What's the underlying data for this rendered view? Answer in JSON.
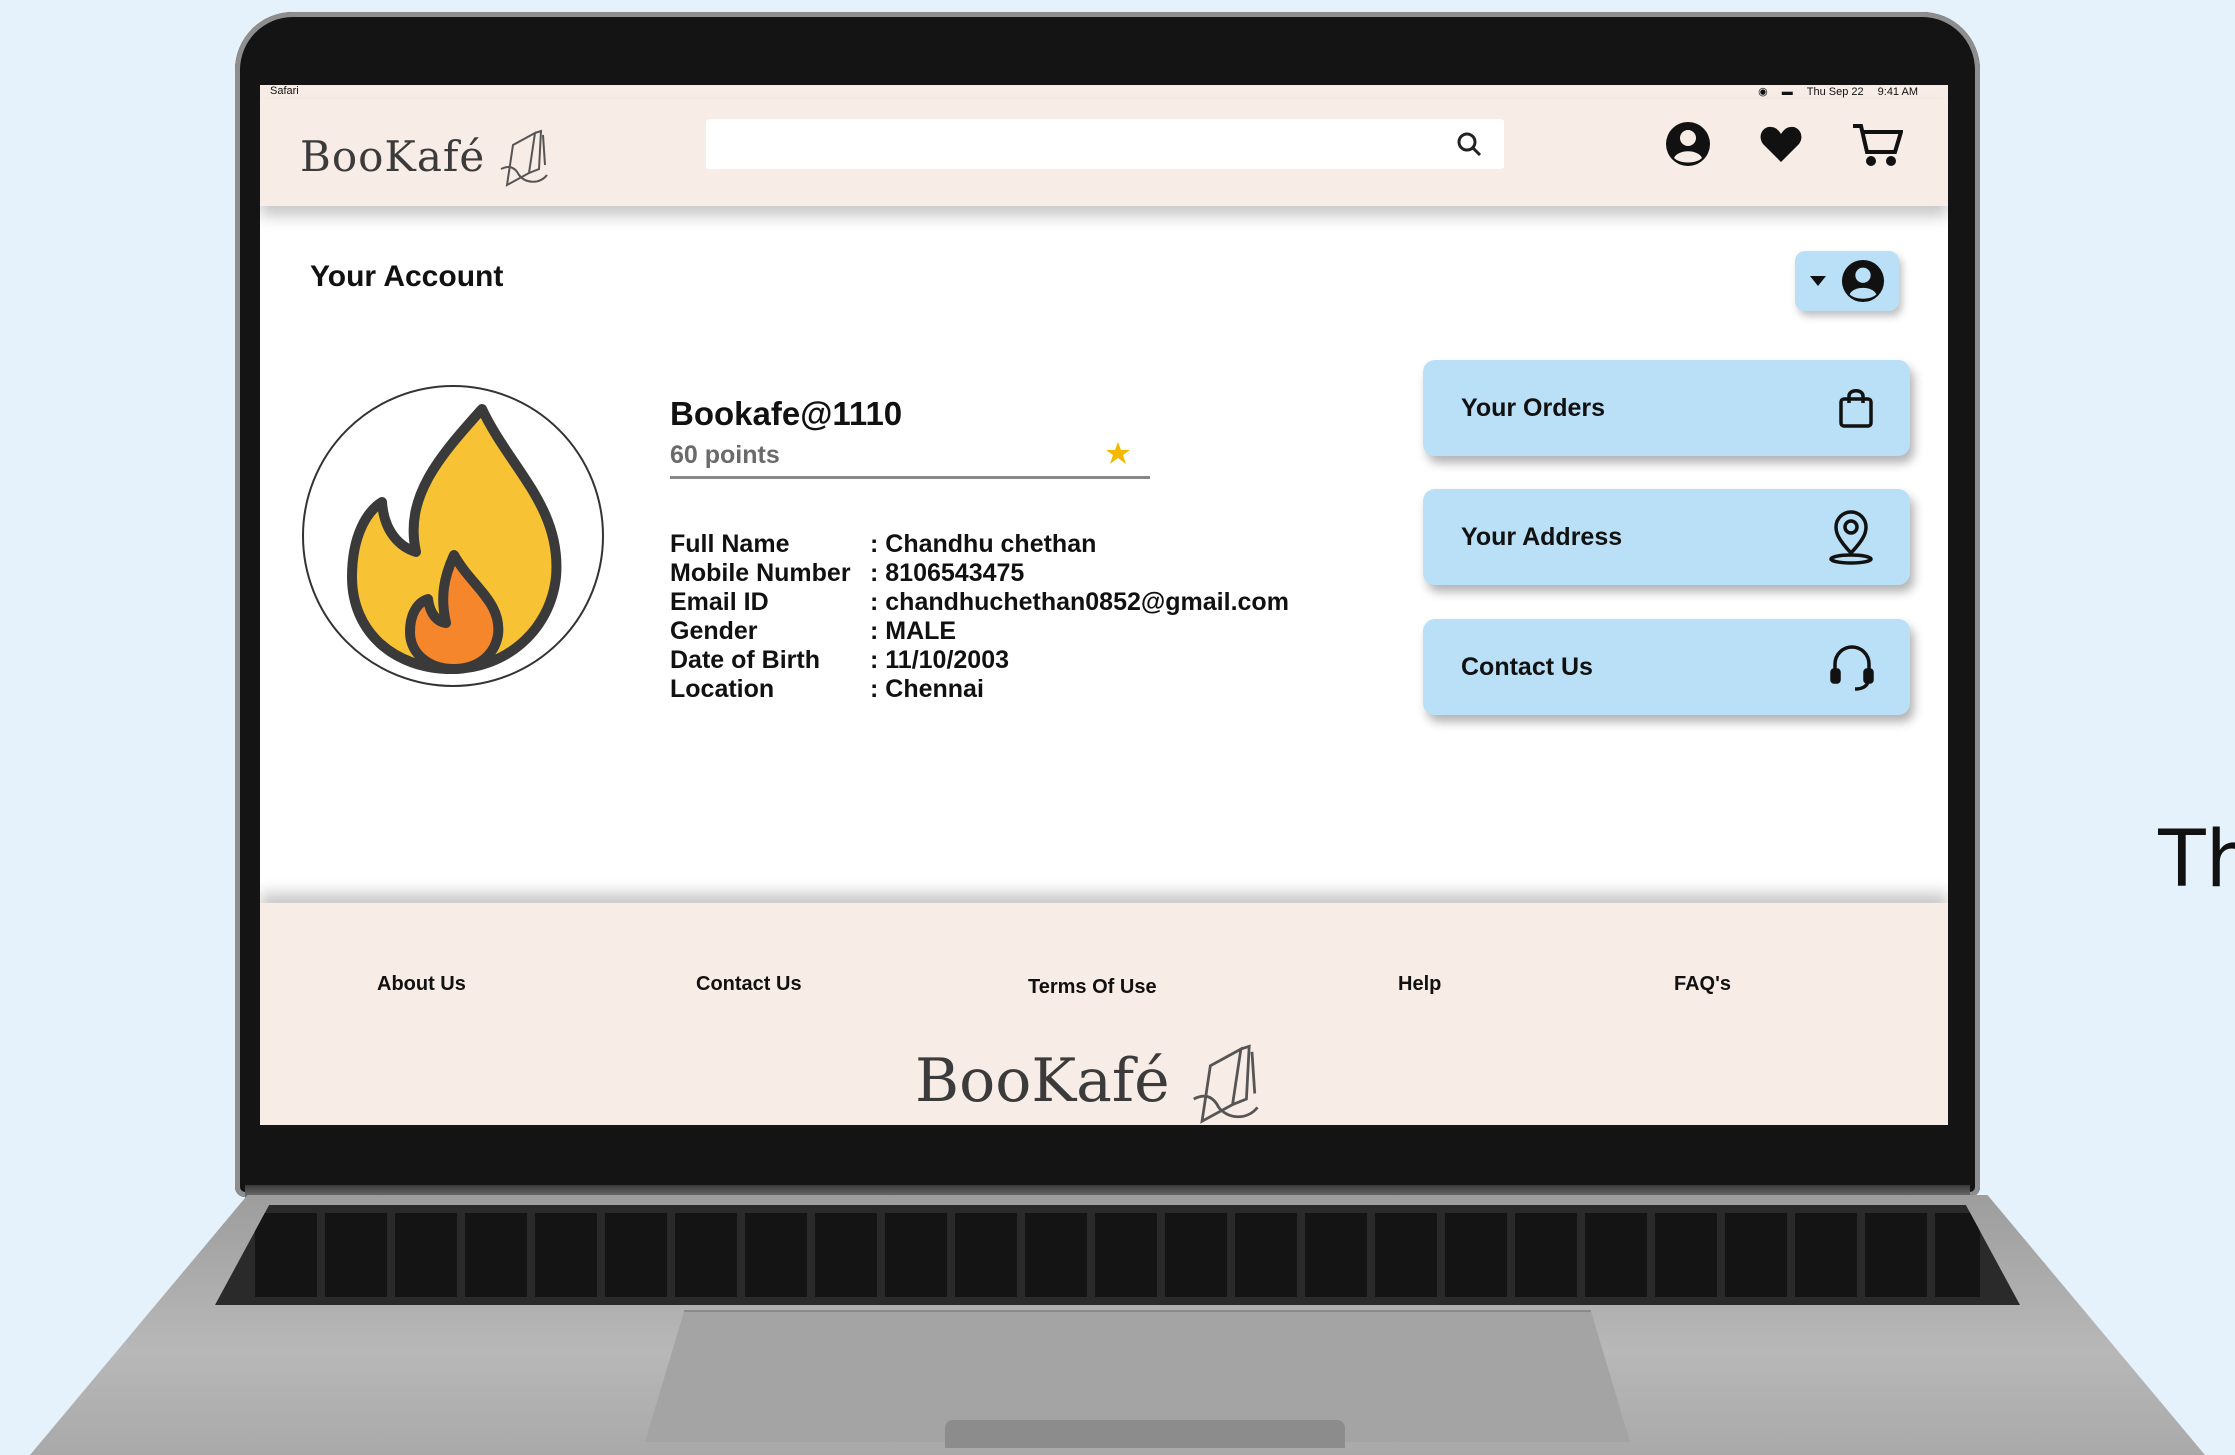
{
  "side_text": "Th",
  "status": {
    "left": "Safari",
    "date": "Thu Sep 22",
    "time": "9:41 AM"
  },
  "brand": {
    "logo_text": "BooKafé",
    "accent": "#b9e0f7",
    "bar_color": "#f8ece6"
  },
  "search": {
    "placeholder": ""
  },
  "page": {
    "title": "Your Account"
  },
  "profile": {
    "username": "Bookafe@1110",
    "points": "60 points",
    "details": [
      {
        "label": "Full Name",
        "value": ":  Chandhu chethan"
      },
      {
        "label": "Mobile Number",
        "value": ":  8106543475"
      },
      {
        "label": "Email ID",
        "value": ":  chandhuchethan0852@gmail.com"
      },
      {
        "label": "Gender",
        "value": ": MALE"
      },
      {
        "label": "Date of Birth",
        "value": ": 11/10/2003"
      },
      {
        "label": "Location",
        "value": ": Chennai"
      }
    ]
  },
  "menu": {
    "orders": "Your Orders",
    "address": "Your Address",
    "contact": "Contact Us"
  },
  "footer": {
    "links": [
      "About Us",
      "Contact Us",
      "Terms Of Use",
      "Help",
      "FAQ's"
    ],
    "logo_text": "BooKafé"
  }
}
